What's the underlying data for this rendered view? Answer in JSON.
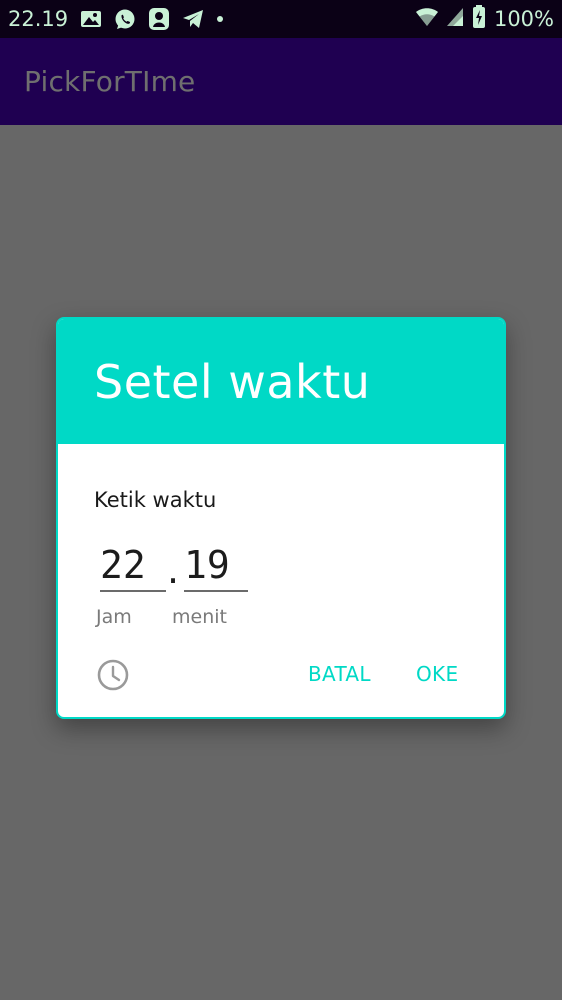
{
  "status_bar": {
    "time": "22.19",
    "battery": "100%",
    "icons": [
      "gallery-icon",
      "whatsapp-icon",
      "app-notification-icon",
      "telegram-icon",
      "dot-icon",
      "wifi-icon",
      "signal-icon",
      "battery-charging-icon"
    ]
  },
  "app_bar": {
    "title": "PickForTIme"
  },
  "dialog": {
    "title": "Setel waktu",
    "input_heading": "Ketik waktu",
    "hours_value": "22",
    "separator": ".",
    "minutes_value": "19",
    "hours_label": "Jam",
    "minutes_label": "menit",
    "mode_toggle_icon": "clock-icon",
    "cancel_label": "BATAL",
    "ok_label": "OKE"
  },
  "colors": {
    "accent": "#00d9c6",
    "app_bar": "#1f0051",
    "status_bar": "#0b0116",
    "scrim": "#676767"
  }
}
